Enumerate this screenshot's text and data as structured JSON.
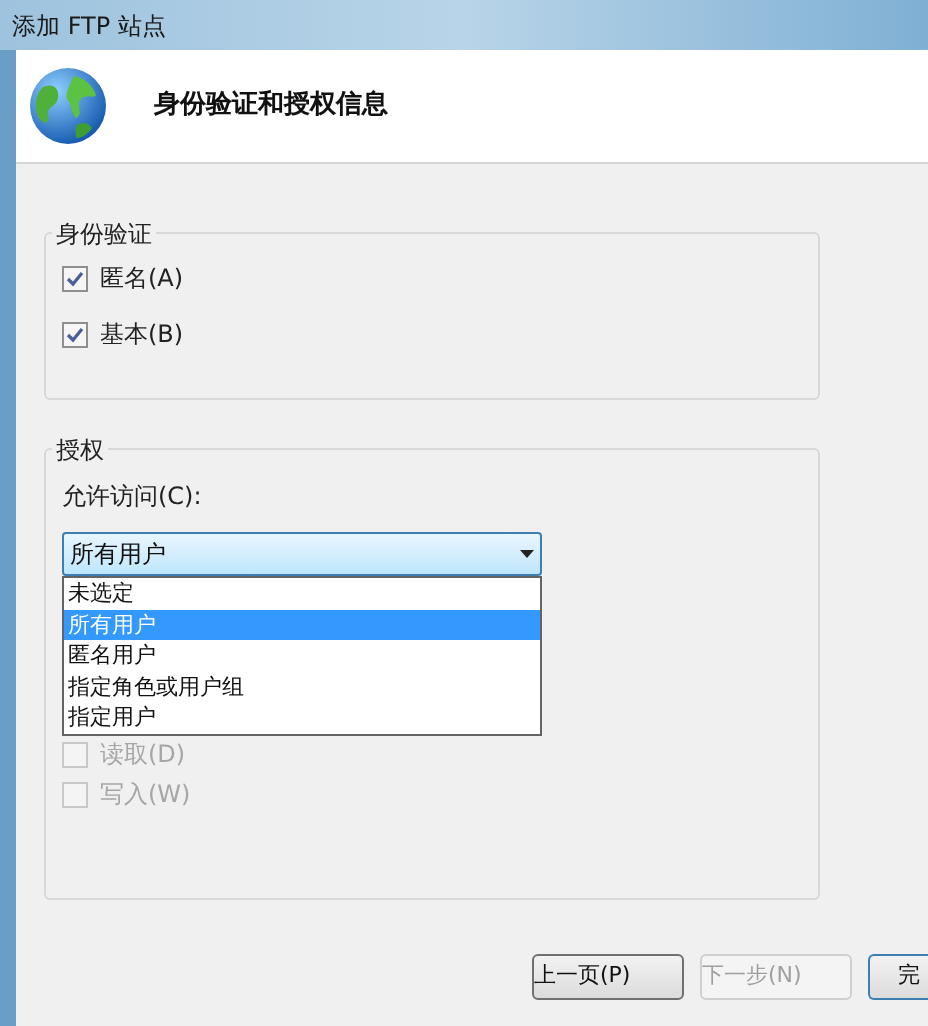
{
  "window": {
    "title": "添加 FTP 站点"
  },
  "header": {
    "title": "身份验证和授权信息"
  },
  "authentication": {
    "title": "身份验证",
    "options": [
      {
        "label": "匿名(A)",
        "checked": true
      },
      {
        "label": "基本(B)",
        "checked": true
      }
    ]
  },
  "authorization": {
    "title": "授权",
    "allow_access_label": "允许访问(C):",
    "dropdown": {
      "value": "所有用户",
      "expanded": true,
      "options": [
        {
          "label": "未选定",
          "selected": false
        },
        {
          "label": "所有用户",
          "selected": true
        },
        {
          "label": "匿名用户",
          "selected": false
        },
        {
          "label": "指定角色或用户组",
          "selected": false
        },
        {
          "label": "指定用户",
          "selected": false
        }
      ]
    },
    "permissions": [
      {
        "label": "读取(D)",
        "checked": false,
        "disabled": true
      },
      {
        "label": "写入(W)",
        "checked": false,
        "disabled": true
      }
    ]
  },
  "buttons": [
    {
      "label": "上一页(P)",
      "disabled": false,
      "default": false
    },
    {
      "label": "下一步(N)",
      "disabled": true,
      "default": false
    },
    {
      "label": "完",
      "disabled": false,
      "default": true
    }
  ]
}
